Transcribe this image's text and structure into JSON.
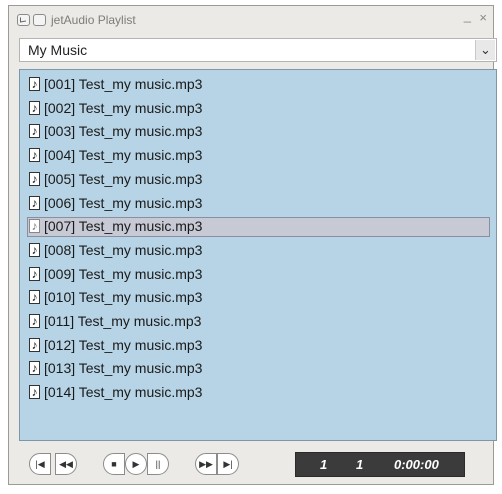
{
  "window": {
    "title": "jetAudio Playlist",
    "minimize_glyph": "_",
    "close_glyph": "×"
  },
  "dropdown": {
    "selected": "My Music",
    "arrow_icon": "chevron-down-icon"
  },
  "playlist": {
    "selected_index": 6,
    "items": [
      "[001] Test_my music.mp3",
      "[002] Test_my music.mp3",
      "[003] Test_my music.mp3",
      "[004] Test_my music.mp3",
      "[005] Test_my music.mp3",
      "[006] Test_my music.mp3",
      "[007] Test_my music.mp3",
      "[008] Test_my music.mp3",
      "[009] Test_my music.mp3",
      "[010] Test_my music.mp3",
      "[011] Test_my music.mp3",
      "[012] Test_my music.mp3",
      "[013] Test_my music.mp3",
      "[014] Test_my music.mp3"
    ]
  },
  "controls": {
    "buttons": [
      {
        "name": "previous-track-icon",
        "glyph": "|◀"
      },
      {
        "name": "rewind-icon",
        "glyph": "◀◀"
      },
      {
        "name": "stop-icon",
        "glyph": "■"
      },
      {
        "name": "play-icon",
        "glyph": "▶"
      },
      {
        "name": "pause-icon",
        "glyph": "||"
      },
      {
        "name": "fast-forward-icon",
        "glyph": "▶▶"
      },
      {
        "name": "next-track-icon",
        "glyph": "▶|"
      }
    ],
    "display": {
      "track": "1",
      "total": "1",
      "time": "0:00:00"
    }
  }
}
